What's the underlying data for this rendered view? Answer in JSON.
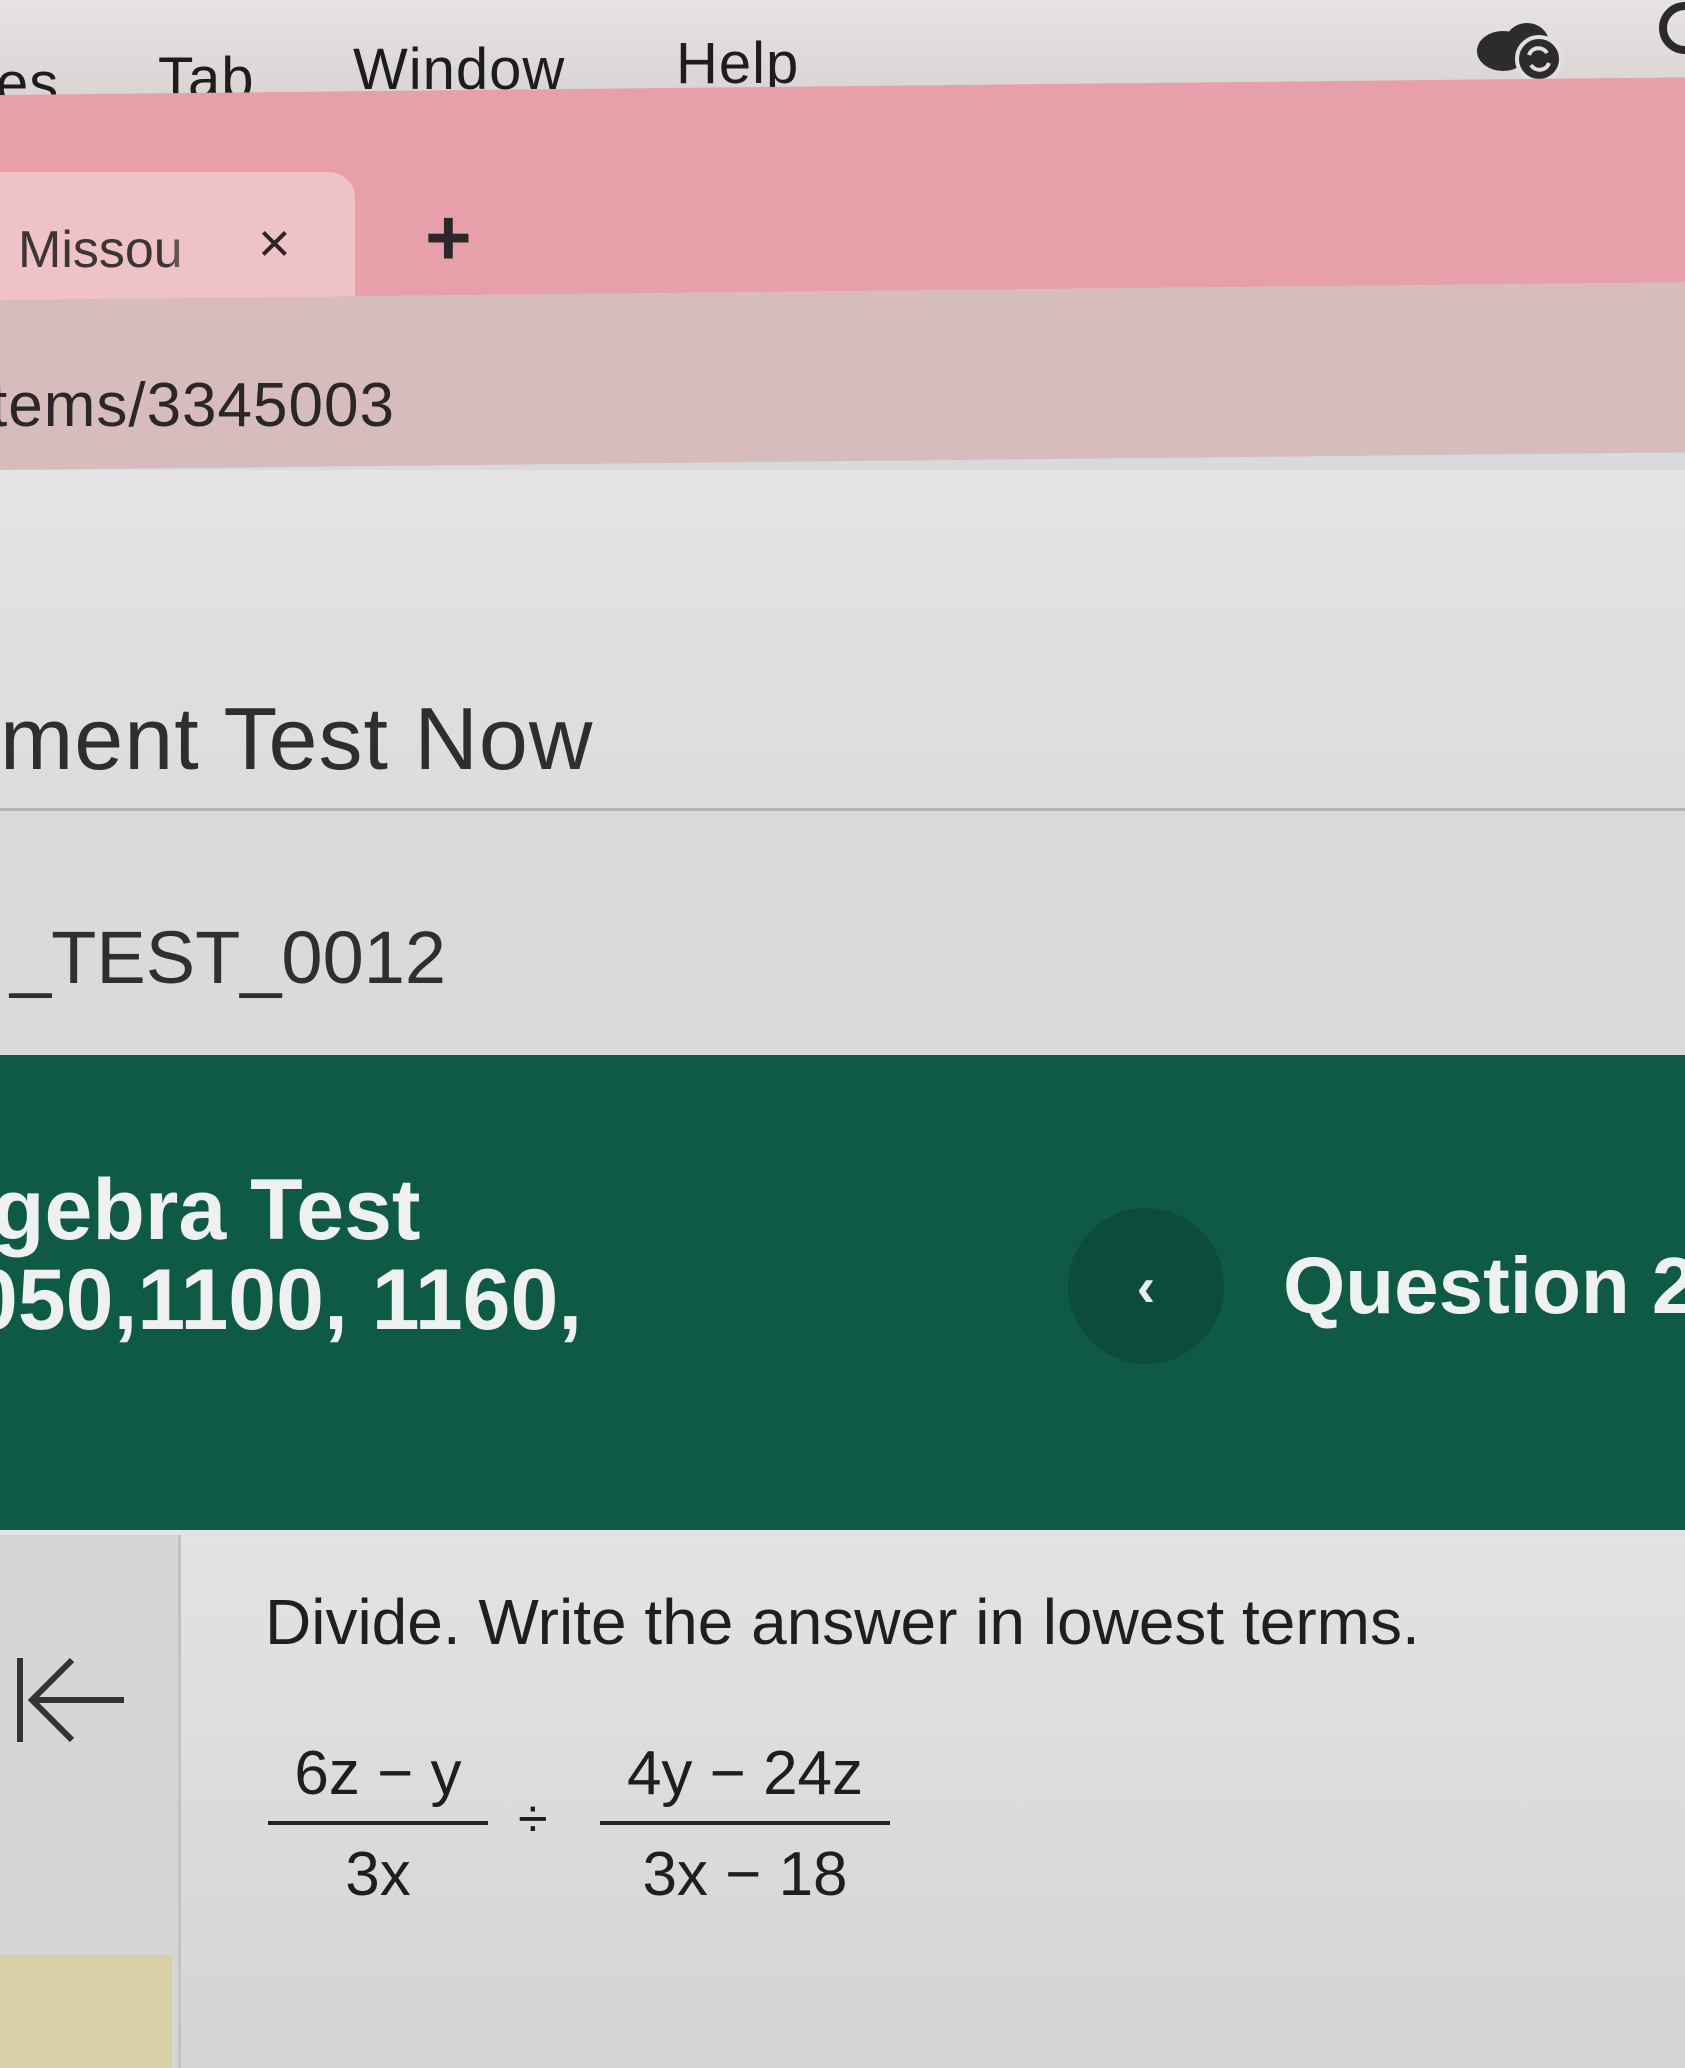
{
  "menubar": {
    "items": [
      "es",
      "Tab",
      "Window",
      "Help"
    ]
  },
  "tabs": {
    "active_title": "Missou",
    "close_glyph": "×",
    "new_tab_glyph": "+"
  },
  "address": {
    "url_fragment": "tems/3345003"
  },
  "page": {
    "title": "ment Test Now",
    "test_code": "_TEST_0012"
  },
  "banner": {
    "course_title": "gebra Test",
    "course_codes": "050,1100, 1160,",
    "prev_glyph": "‹",
    "question_label": "Question 2"
  },
  "question": {
    "instruction": "Divide. Write the answer in lowest terms.",
    "frac1": {
      "numerator": "6z − y",
      "denominator": "3x"
    },
    "operator": "÷",
    "frac2": {
      "numerator": "4y − 24z",
      "denominator": "3x − 18"
    }
  },
  "icons": {
    "cloud": "cloud-sync-icon",
    "collapse": "collapse-left-icon"
  },
  "colors": {
    "tab_strip": "#e79fa9",
    "active_tab": "#efc3c6",
    "address_bar": "#d7bcbd",
    "banner_green": "#0f5a46"
  }
}
